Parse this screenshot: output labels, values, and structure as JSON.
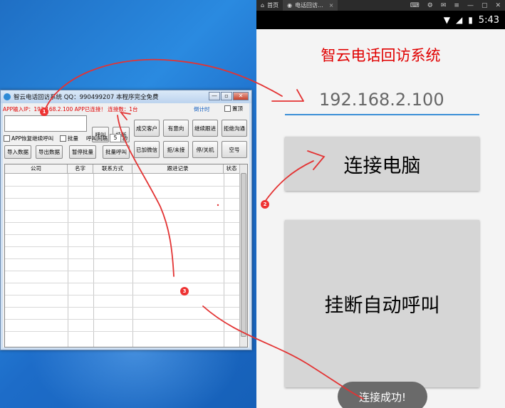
{
  "windows_app": {
    "title": "智云电话回访系统    QQ：990499207    本程序完全免费",
    "window_controls": {
      "minimize": "—",
      "maximize": "▫",
      "close": "✕"
    },
    "status_text": "APP输入IP：192.168.2.100 APP已连接！ 连接数：1台",
    "countdown_link": "倒计时",
    "pin_label": "置顶",
    "phone_input_value": "",
    "buttons": {
      "call": "呼叫",
      "hangup": "挂断",
      "deal_customer": "成交客户",
      "interested": "有意向",
      "continue_follow": "继续跟进",
      "refuse": "拒绝沟通",
      "added_wechat": "已加微信",
      "refused_unanswered": "拒/未接",
      "stopped_off": "停/关机",
      "empty_number": "空号",
      "import_data": "导入数据",
      "export_data": "导出数据",
      "pause_batch": "暂停批量",
      "batch_call": "批量呼叫"
    },
    "checkboxes": {
      "skip_called": "APP恢复继续呼叫",
      "batch": "批量"
    },
    "interval_label": "呼叫间隔",
    "interval_value": "5",
    "seconds_unit": "秒",
    "table": {
      "columns": [
        "公司",
        "名字",
        "联系方式",
        "跟进记录",
        "状态"
      ],
      "rows": []
    }
  },
  "phone_app": {
    "emulator_tabs": [
      {
        "label": "首页",
        "icon": "⌂"
      },
      {
        "label": "电话回访...",
        "icon": "◉"
      }
    ],
    "emulator_tools": [
      "⌨",
      "⚙",
      "✉",
      "≡",
      "—",
      "▢",
      "✕"
    ],
    "status_time": "5:43",
    "title": "智云电话回访系统",
    "ip_value": "192.168.2.100",
    "connect_button": "连接电脑",
    "hangup_auto_button": "挂断自动呼叫",
    "toast": "连接成功!"
  },
  "annotations": {
    "badges": [
      "1",
      "2",
      "3"
    ],
    "color": "#e33333"
  }
}
